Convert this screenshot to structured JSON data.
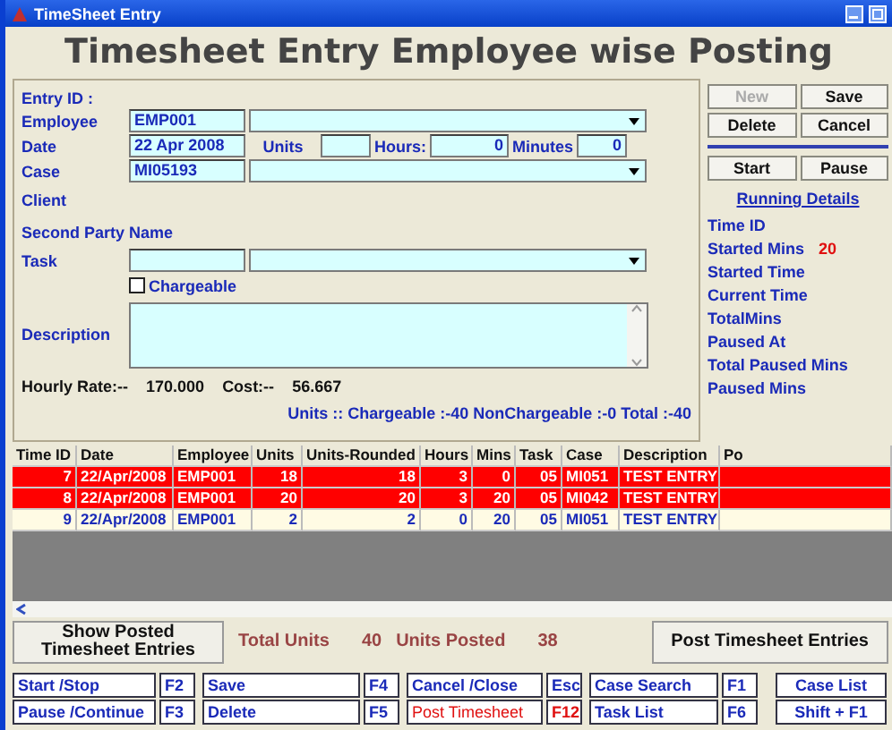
{
  "window": {
    "title": "TimeSheet Entry"
  },
  "heading": "Timesheet Entry Employee wise Posting",
  "form": {
    "entry_id_label": "Entry ID :",
    "employee": {
      "label": "Employee",
      "code": "EMP001"
    },
    "date": {
      "label": "Date",
      "value": "22 Apr 2008",
      "units_label": "Units",
      "hours_label": "Hours:",
      "hours": "0",
      "minutes_label": "Minutes",
      "minutes": "0"
    },
    "case": {
      "label": "Case",
      "code": "MI05193"
    },
    "client_label": "Client",
    "second_party_label": "Second Party Name",
    "task": {
      "label": "Task"
    },
    "chargeable": {
      "label": "Chargeable",
      "checked": false
    },
    "description_label": "Description",
    "hourly_rate_label": "Hourly Rate:--",
    "hourly_rate": "170.000",
    "cost_label": "Cost:--",
    "cost": "56.667",
    "summary": "Units :: Chargeable :-40  NonChargeable :-0  Total :-40"
  },
  "actions": [
    {
      "label": "New",
      "disabled": true
    },
    {
      "label": "Save",
      "disabled": false
    },
    {
      "label": "Delete",
      "disabled": false
    },
    {
      "label": "Cancel",
      "disabled": false
    }
  ],
  "timer_buttons": [
    "Start",
    "Pause"
  ],
  "running_details": {
    "title": "Running Details",
    "items": [
      {
        "label": "Time ID"
      },
      {
        "label": "Started Mins",
        "value": "20"
      },
      {
        "label": "Started Time"
      },
      {
        "label": "Current Time"
      },
      {
        "label": "TotalMins"
      },
      {
        "label": "Paused At"
      },
      {
        "label": "Total Paused Mins"
      },
      {
        "label": "Paused Mins"
      }
    ]
  },
  "table": {
    "columns": [
      "Time ID",
      "Date",
      "Employee",
      "Units",
      "Units-Rounded",
      "Hours",
      "Mins",
      "Task",
      "Case",
      "Description",
      "Po"
    ],
    "rows": [
      {
        "cells": [
          "7",
          "22/Apr/2008",
          "EMP001",
          "18",
          "18",
          "3",
          "0",
          "05",
          "MI051",
          "TEST ENTRY"
        ],
        "highlighted": true
      },
      {
        "cells": [
          "8",
          "22/Apr/2008",
          "EMP001",
          "20",
          "20",
          "3",
          "20",
          "05",
          "MI042",
          "TEST ENTRY"
        ],
        "highlighted": true
      },
      {
        "cells": [
          "9",
          "22/Apr/2008",
          "EMP001",
          "2",
          "2",
          "0",
          "20",
          "05",
          "MI051",
          "TEST ENTRY"
        ],
        "highlighted": false
      }
    ]
  },
  "totals": {
    "show_posted": "Show Posted Timesheet Entries",
    "total_units_label": "Total Units",
    "total_units": "40",
    "units_posted_label": "Units Posted",
    "units_posted": "38",
    "post_button": "Post Timesheet Entries"
  },
  "shortcuts": [
    [
      {
        "label": "Start /Stop",
        "key": "F2",
        "highlighted": false
      },
      {
        "label": "Pause /Continue",
        "key": "F3",
        "highlighted": false
      }
    ],
    [
      {
        "label": "Save",
        "key": "F4",
        "highlighted": false
      },
      {
        "label": "Delete",
        "key": "F5",
        "highlighted": false
      }
    ],
    [
      {
        "label": "Cancel /Close",
        "key": "Esc",
        "highlighted": false
      },
      {
        "label": "Post Timesheet",
        "key": "F12",
        "highlighted": true
      }
    ],
    [
      {
        "label": "Case Search",
        "key": "F1",
        "highlighted": false
      },
      {
        "label": "Task List",
        "key": "F6",
        "highlighted": false
      }
    ]
  ],
  "case_list": {
    "label": "Case List",
    "key": "Shift + F1"
  }
}
